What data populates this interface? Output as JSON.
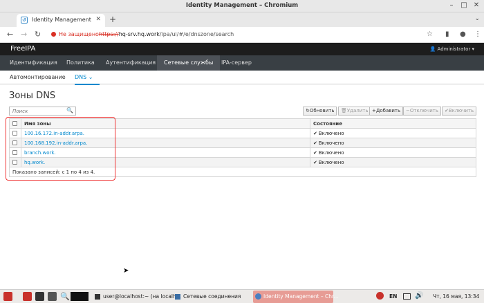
{
  "window": {
    "title": "Identity Management – Chromium"
  },
  "browser": {
    "tab_title": "Identity Management",
    "security_label": "Не защищено",
    "url_scheme": "https://",
    "url_host": "hq-srv.hq.work",
    "url_path": "/ipa/ui/#/e/dnszone/search"
  },
  "ipa": {
    "logo": "FreeIPA",
    "user": "Administrator",
    "nav": [
      "Идентификация",
      "Политика",
      "Аутентификация",
      "Сетевые службы",
      "IPA-сервер"
    ],
    "active_nav": "Сетевые службы",
    "subnav": [
      "Автомонтирование",
      "DNS"
    ],
    "active_subnav": "DNS",
    "page_title": "Зоны DNS",
    "search_placeholder": "Поиск",
    "buttons": {
      "refresh": "Обновить",
      "delete": "Удалить",
      "add": "Добавить",
      "disable": "Отключить",
      "enable": "Включить"
    },
    "table": {
      "col_zone": "Имя зоны",
      "col_status": "Состояние",
      "rows": [
        {
          "zone": "100.16.172.in-addr.arpa.",
          "status": "Включено"
        },
        {
          "zone": "100.168.192.in-addr.arpa.",
          "status": "Включено"
        },
        {
          "zone": "branch.work.",
          "status": "Включено"
        },
        {
          "zone": "hq.work.",
          "status": "Включено"
        }
      ],
      "footer": "Показано записей: с 1 по 4 из 4."
    }
  },
  "taskbar": {
    "terminal": "user@localhost:~ (на localh...",
    "network": "Сетевые соединения",
    "browser": "Identity Management – Chr...",
    "lang": "EN",
    "clock": "Чт, 16 мая, 13:34"
  },
  "colors": {
    "accent": "#0088ce",
    "nav_bg": "#393f44",
    "highlight": "#e33333"
  }
}
